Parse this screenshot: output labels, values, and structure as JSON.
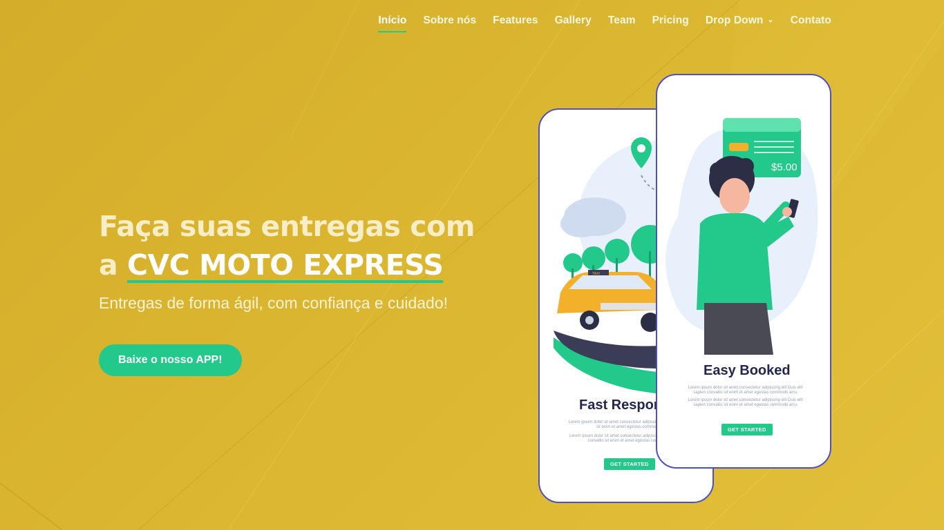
{
  "nav": {
    "items": [
      {
        "label": "Início",
        "active": true
      },
      {
        "label": "Sobre nós"
      },
      {
        "label": "Features"
      },
      {
        "label": "Gallery"
      },
      {
        "label": "Team"
      },
      {
        "label": "Pricing"
      },
      {
        "label": "Drop Down",
        "dropdown": true
      },
      {
        "label": "Contato"
      }
    ]
  },
  "hero": {
    "title_line1": "Faça suas entregas com",
    "title_prefix": "a ",
    "title_brand": "CVC MOTO EXPRESS",
    "subtitle": "Entregas de forma ágil, com confiança e cuidado!",
    "cta_label": "Baixe o nosso APP!"
  },
  "phones": {
    "back": {
      "title": "Fast Respor",
      "lorem1": "Lorem ipsum dolor sit amet consectetur adipiscing elit sapien convallis sit enim et amet egestas commodo arcu",
      "lorem2": "Lorem ipsum dolor sit amet consectetur adipiscing elit Duis elit sapien convallis sit enim et amet egestas commodo arcu",
      "button": "GET STARTED",
      "taxi_sign": "TAXI"
    },
    "front": {
      "title": "Easy Booked",
      "lorem1": "Lorem ipsum dolor sit amet consectetur adipiscing elit Duis elit sapien convallis sit enim et amet egestas commodo arcu",
      "lorem2": "Lorem ipsum dolor sit amet consectetur adipiscing elit Duis elit sapien convallis sit enim et amet egestas commodo arcu",
      "button": "GET STARTED",
      "price": "$5.00"
    }
  },
  "colors": {
    "background": "#d9b52d",
    "accent": "#22c98b",
    "phone_border": "#4d4fc7",
    "heading_dark": "#23264f"
  }
}
